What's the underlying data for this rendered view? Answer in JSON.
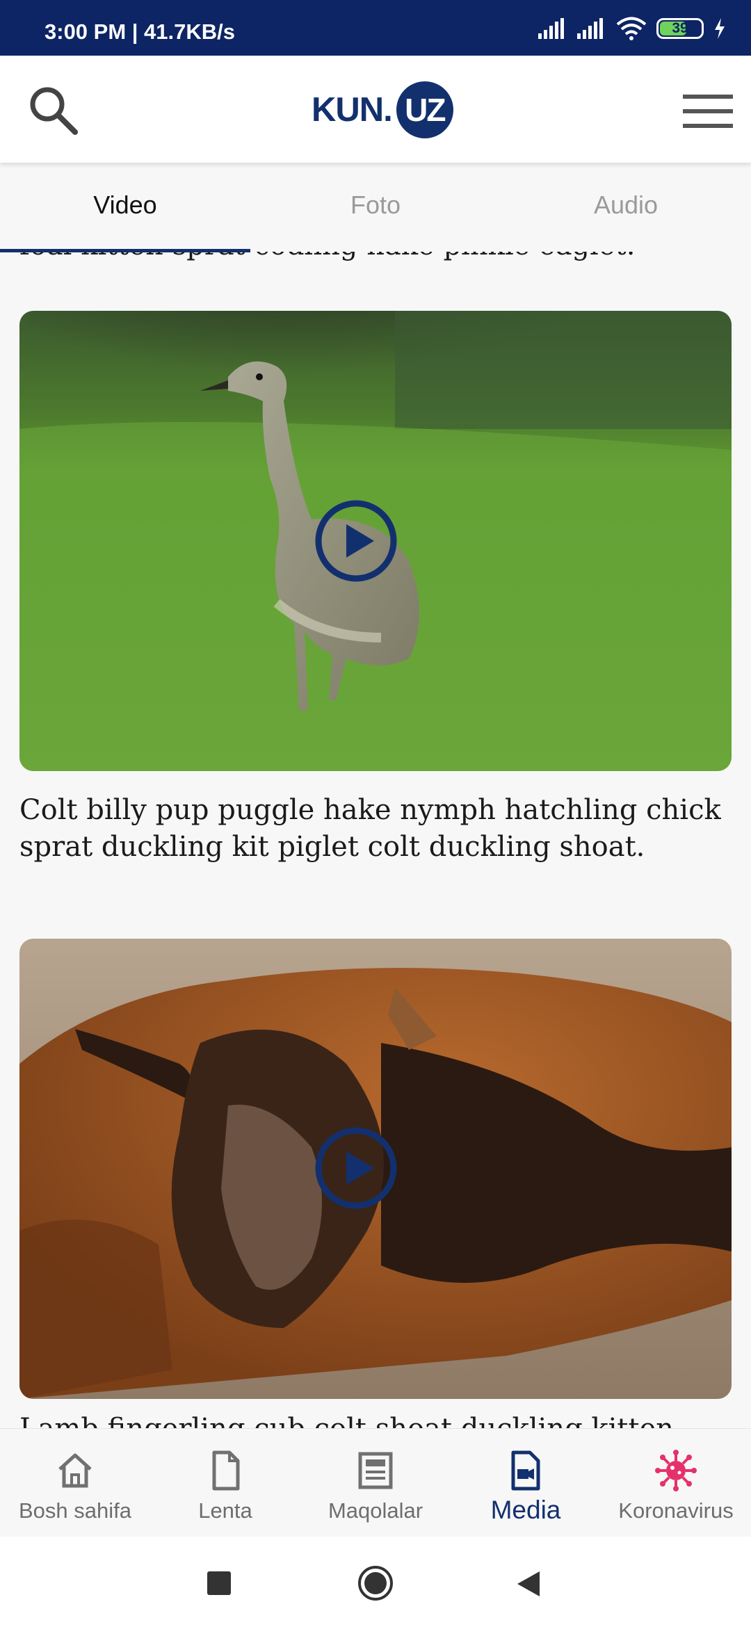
{
  "status_bar": {
    "time": "3:00 PM | 41.7KB/s",
    "battery": "39"
  },
  "header": {
    "logo_text": "KUN.",
    "logo_circle_text": "UZ"
  },
  "tabs": [
    {
      "label": "Video",
      "active": true
    },
    {
      "label": "Foto",
      "active": false
    },
    {
      "label": "Audio",
      "active": false
    }
  ],
  "content": {
    "partial_caption_top": "foal kitten sprat codling hake pinkie eaglet.",
    "cards": [
      {
        "caption": "Colt billy pup puggle hake nymph hatchling chick sprat duckling kit piglet colt duckling shoat.",
        "image": "gosling on grass"
      },
      {
        "caption": "",
        "image": "sleeping brown goat kid"
      }
    ],
    "partial_caption_bottom": "Lamb fingerling cub colt shoat duckling kitten"
  },
  "bottom_nav": [
    {
      "label": "Bosh sahifa",
      "icon": "home-icon"
    },
    {
      "label": "Lenta",
      "icon": "document-icon"
    },
    {
      "label": "Maqolalar",
      "icon": "article-icon"
    },
    {
      "label": "Media",
      "icon": "media-icon",
      "active": true
    },
    {
      "label": "Koronavirus",
      "icon": "virus-icon"
    }
  ],
  "colors": {
    "brand": "#13306e",
    "status_bar": "#0d2465",
    "virus_icon": "#e5316a"
  }
}
